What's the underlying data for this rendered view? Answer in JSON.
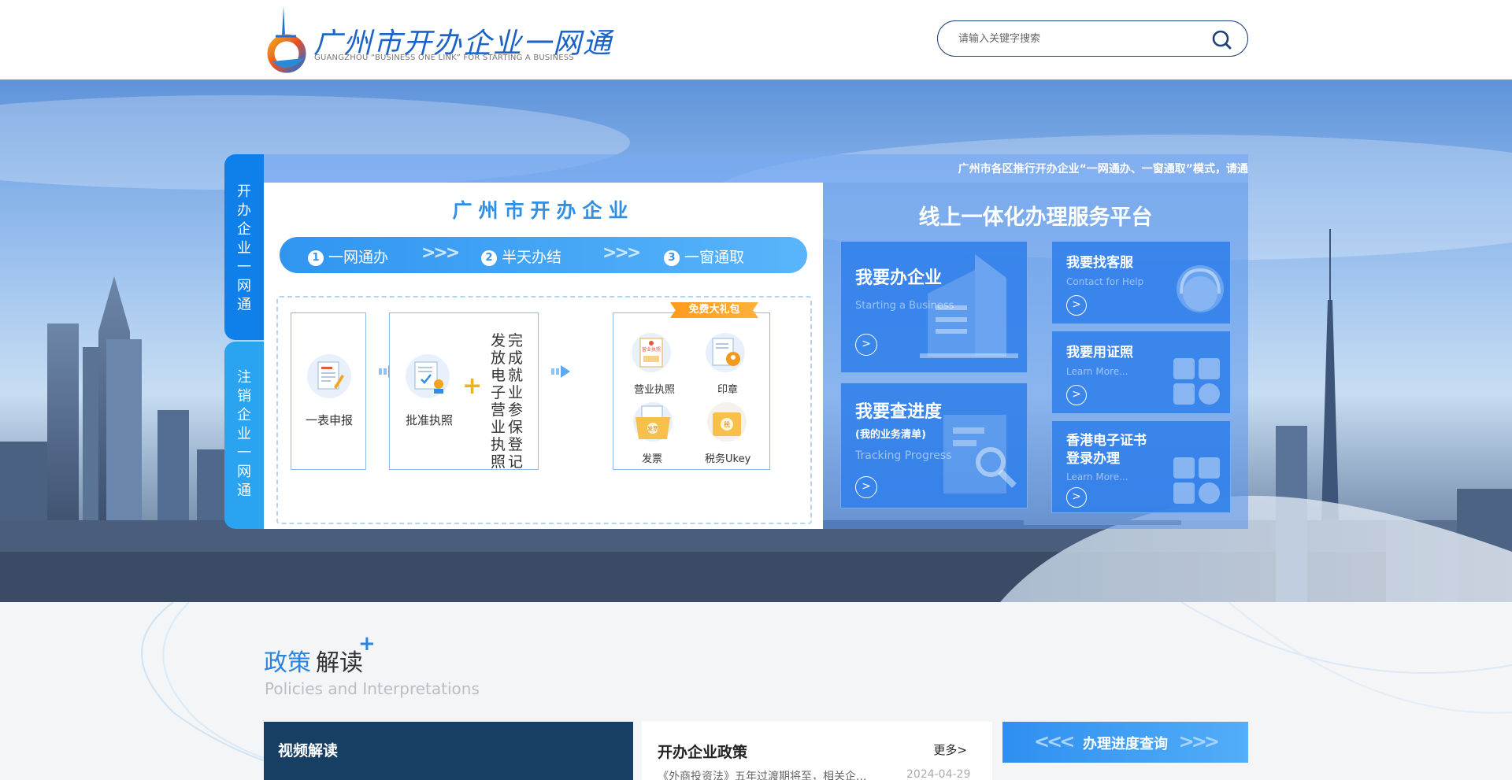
{
  "header": {
    "logo_title": "广州市开办企业一网通",
    "logo_subtitle": "GUANGZHOU “BUSINESS ONE LINK” FOR STARTING A BUSINESS",
    "search_placeholder": "请输入关键字搜索"
  },
  "side_tabs": [
    {
      "label": "开办企业一网通"
    },
    {
      "label": "注销企业一网通"
    }
  ],
  "marquee": "广州市各区推行开办企业“一网通办、一窗通取”模式，请通",
  "flow": {
    "title": "广州市开办企业",
    "steps": [
      {
        "num": "1",
        "label": "一网通办"
      },
      {
        "num": "2",
        "label": "半天办结"
      },
      {
        "num": "3",
        "label": "一窗通取"
      }
    ],
    "card1_label": "一表申报",
    "card2_label": "批准执照",
    "card2_vertical_1": "完成就业参保登记",
    "card2_vertical_2": "发放电子营业执照",
    "gift_badge": "免费大礼包",
    "gift_items": [
      {
        "label": "营业执照"
      },
      {
        "label": "印章"
      },
      {
        "label": "发票"
      },
      {
        "label": "税务Ukey"
      }
    ],
    "license_icon_text": "营业执照",
    "invoice_icon_text": "发票",
    "tax_icon_text": "税"
  },
  "platform": {
    "title": "线上一体化办理服务平台",
    "tiles": [
      {
        "title": "我要办企业",
        "sub": "Starting a Business"
      },
      {
        "title": "我要查进度",
        "note": "(我的业务清单)",
        "sub": "Tracking Progress"
      },
      {
        "title": "我要找客服",
        "sub": "Contact for Help"
      },
      {
        "title": "我要用证照",
        "sub": "Learn More..."
      },
      {
        "title_line1": "香港电子证书",
        "title_line2": "登录办理",
        "sub": "Learn More..."
      }
    ]
  },
  "policies": {
    "title_a": "政策",
    "title_b": "解读",
    "plus": "+",
    "subtitle": "Policies and Interpretations",
    "video_title": "视频解读",
    "policy_title": "开办企业政策",
    "more": "更多>",
    "items": [
      {
        "title": "《外商投资法》五年过渡期将至，相关企...",
        "date": "2024-04-29"
      }
    ],
    "progress_label": "办理进度查询"
  },
  "colors": {
    "brand_blue": "#1a63c9",
    "accent_blue": "#2f8fe5",
    "dark_navy": "#173f63",
    "tab_blue": "#0f7fe9",
    "tab_light": "#2aa3f1",
    "gift_orange": "#ff9a1e"
  },
  "icons": {
    "search": "search-icon",
    "arrow": "circle-chevron-right-icon"
  }
}
